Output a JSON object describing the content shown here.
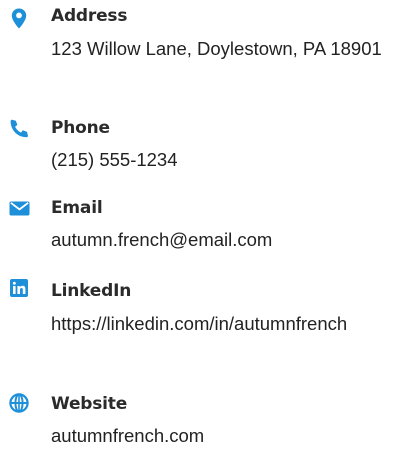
{
  "accent_color": "#1e8fd9",
  "contacts": [
    {
      "icon": "map-pin-icon",
      "label": "Address",
      "value": "123 Willow Lane, Doylestown, PA 18901"
    },
    {
      "icon": "phone-icon",
      "label": "Phone",
      "value": "(215) 555-1234"
    },
    {
      "icon": "envelope-icon",
      "label": "Email",
      "value": "autumn.french@email.com"
    },
    {
      "icon": "linkedin-icon",
      "label": "LinkedIn",
      "value": "https://linkedin.com/in/autumnfrench"
    },
    {
      "icon": "globe-icon",
      "label": "Website",
      "value": "autumnfrench.com"
    }
  ]
}
